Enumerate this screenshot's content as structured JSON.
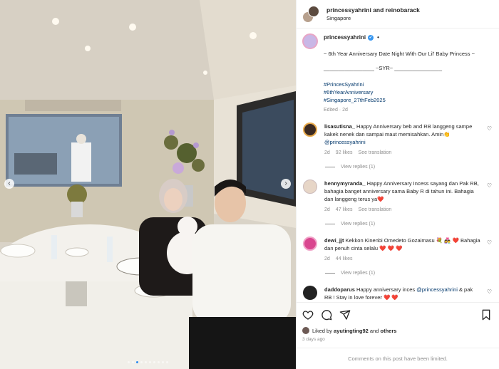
{
  "header": {
    "users": "princessyahrini and reinobarack",
    "location": "Singapore"
  },
  "caption": {
    "username": "princessyahrini",
    "separator": "•",
    "line1": "~ 6th Year Anniversary Date Night With Our Lil' Baby Princess ~",
    "line2": "_________________ ~SYR~ ________________",
    "hashtags": [
      "#PrincesSyahrini",
      "#6thYearAnniversary",
      "#Singapore_27thFeb2025"
    ],
    "edited": "Edited · 2d"
  },
  "comments": [
    {
      "username": "lisasutisna_",
      "text": "Happy Anniversary beb and RB langgeng sampe kakek nenek dan sampai maut memisahkan. Amin👏",
      "mention": "@princessyahrini",
      "time": "2d",
      "likes": "92 likes",
      "translate": "See translation",
      "replies": "View replies (1)",
      "avatar_color": "#3b2a22"
    },
    {
      "username": "hennymyranda_",
      "text": "Happy Anniversary Incess sayang dan Pak RB, bahagia banget anniversary sama Baby R di tahun ini. Bahagia dan langgeng terus ya❤️",
      "mention": "",
      "time": "2d",
      "likes": "47 likes",
      "translate": "See translation",
      "replies": "View replies (1)",
      "avatar_color": "#e7d6c7"
    },
    {
      "username": "dewi_jjt",
      "text": "Kekkon Kinenbi Omedeto Gozaimasu 💐 👩‍❤️‍👨 ❤️ Bahagia dan penuh cinta selalu ❤️ ❤️ ❤️",
      "mention": "",
      "time": "2d",
      "likes": "44 likes",
      "translate": "",
      "replies": "View replies (1)",
      "avatar_color": "#d9468f"
    },
    {
      "username": "daddoparus",
      "text": "Happy anniversary inces",
      "mention": "@princessyahrini",
      "text_after": "& pak RB ! Stay in love forever ❤️ ❤️",
      "time": "",
      "likes": "",
      "translate": "",
      "replies": "",
      "avatar_color": "#222222"
    }
  ],
  "actions": {
    "icons": [
      "heart-icon",
      "comment-icon",
      "share-icon",
      "bookmark-icon"
    ],
    "liked_prefix": "Liked by",
    "liked_user": "ayutingting92",
    "liked_and": "and",
    "liked_others": "others",
    "time_ago": "3 days ago",
    "limited_text": "Comments on this post have been limited."
  },
  "carousel": {
    "prev_label": "‹",
    "next_label": "›",
    "slide_count": 10,
    "active_slide": 2
  },
  "colors": {
    "link": "#00376b",
    "muted": "#8e8e8e",
    "verified": "#3897f0",
    "carousel_active": "#2d8cf0"
  }
}
